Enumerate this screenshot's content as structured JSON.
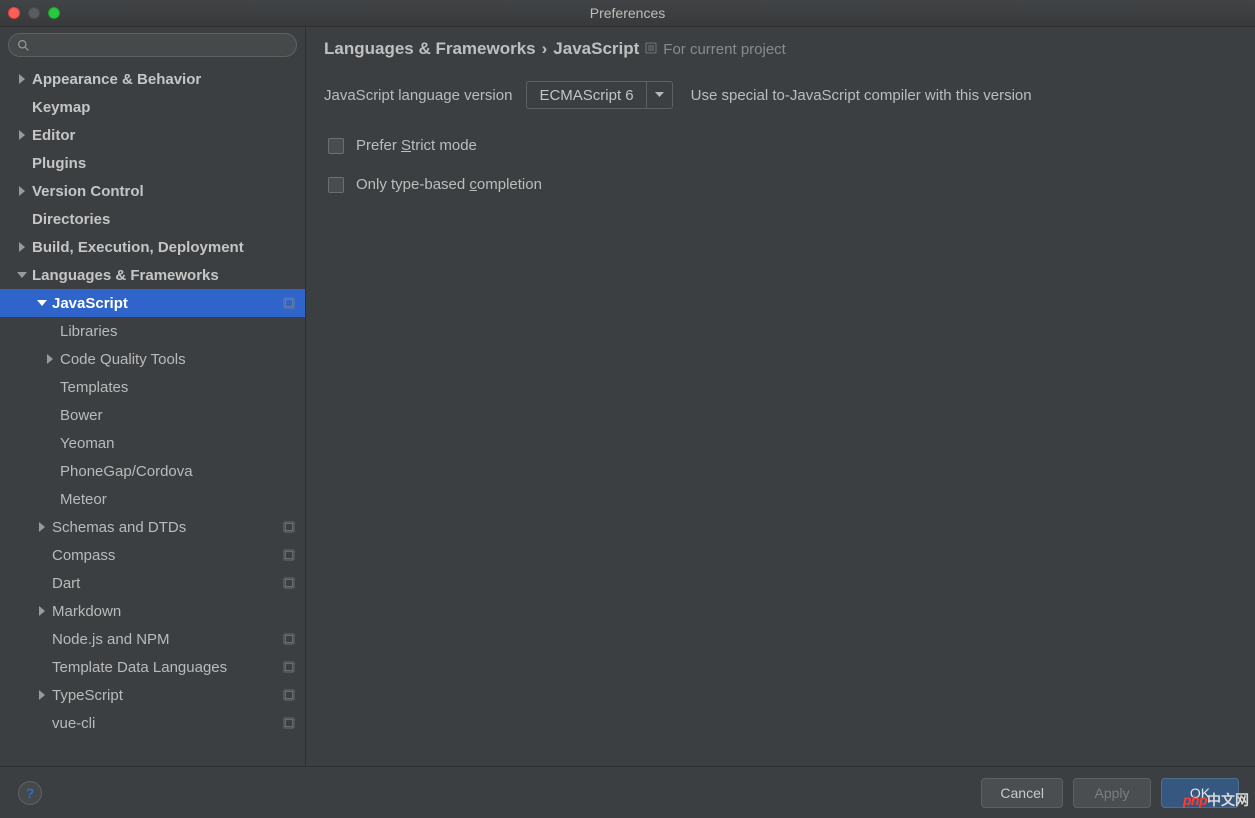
{
  "window": {
    "title": "Preferences"
  },
  "search": {
    "placeholder": ""
  },
  "sidebar": {
    "items": [
      {
        "label": "Appearance & Behavior",
        "depth": 0,
        "expandable": true,
        "expanded": false,
        "bold": true
      },
      {
        "label": "Keymap",
        "depth": 0,
        "expandable": false,
        "bold": true
      },
      {
        "label": "Editor",
        "depth": 0,
        "expandable": true,
        "expanded": false,
        "bold": true
      },
      {
        "label": "Plugins",
        "depth": 0,
        "expandable": false,
        "bold": true
      },
      {
        "label": "Version Control",
        "depth": 0,
        "expandable": true,
        "expanded": false,
        "bold": true
      },
      {
        "label": "Directories",
        "depth": 0,
        "expandable": false,
        "bold": true
      },
      {
        "label": "Build, Execution, Deployment",
        "depth": 0,
        "expandable": true,
        "expanded": false,
        "bold": true
      },
      {
        "label": "Languages & Frameworks",
        "depth": 0,
        "expandable": true,
        "expanded": true,
        "bold": true
      },
      {
        "label": "JavaScript",
        "depth": 1,
        "expandable": true,
        "expanded": true,
        "bold": true,
        "selected": true,
        "project": true
      },
      {
        "label": "Libraries",
        "depth": 2,
        "expandable": false
      },
      {
        "label": "Code Quality Tools",
        "depth": 2,
        "expandable": true,
        "expanded": false
      },
      {
        "label": "Templates",
        "depth": 2,
        "expandable": false
      },
      {
        "label": "Bower",
        "depth": 2,
        "expandable": false
      },
      {
        "label": "Yeoman",
        "depth": 2,
        "expandable": false
      },
      {
        "label": "PhoneGap/Cordova",
        "depth": 2,
        "expandable": false
      },
      {
        "label": "Meteor",
        "depth": 2,
        "expandable": false
      },
      {
        "label": "Schemas and DTDs",
        "depth": 1,
        "expandable": true,
        "expanded": false,
        "project": true
      },
      {
        "label": "Compass",
        "depth": 1,
        "expandable": false,
        "project": true
      },
      {
        "label": "Dart",
        "depth": 1,
        "expandable": false,
        "project": true
      },
      {
        "label": "Markdown",
        "depth": 1,
        "expandable": true,
        "expanded": false
      },
      {
        "label": "Node.js and NPM",
        "depth": 1,
        "expandable": false,
        "project": true
      },
      {
        "label": "Template Data Languages",
        "depth": 1,
        "expandable": false,
        "project": true
      },
      {
        "label": "TypeScript",
        "depth": 1,
        "expandable": true,
        "expanded": false,
        "project": true
      },
      {
        "label": "vue-cli",
        "depth": 1,
        "expandable": false,
        "project": true
      }
    ]
  },
  "breadcrumb": {
    "parent": "Languages & Frameworks",
    "current": "JavaScript",
    "scope": "For current project"
  },
  "form": {
    "version_label": "JavaScript language version",
    "version_value": "ECMAScript 6",
    "version_hint": "Use special to-JavaScript compiler with this version",
    "prefer_strict_pre": "Prefer ",
    "prefer_strict_mnemonic": "S",
    "prefer_strict_post": "trict mode",
    "only_type_pre": "Only type-based ",
    "only_type_mnemonic": "c",
    "only_type_post": "ompletion"
  },
  "buttons": {
    "help": "?",
    "cancel": "Cancel",
    "apply": "Apply",
    "ok": "OK"
  },
  "watermark": {
    "left": "php",
    "right": "中文网"
  }
}
